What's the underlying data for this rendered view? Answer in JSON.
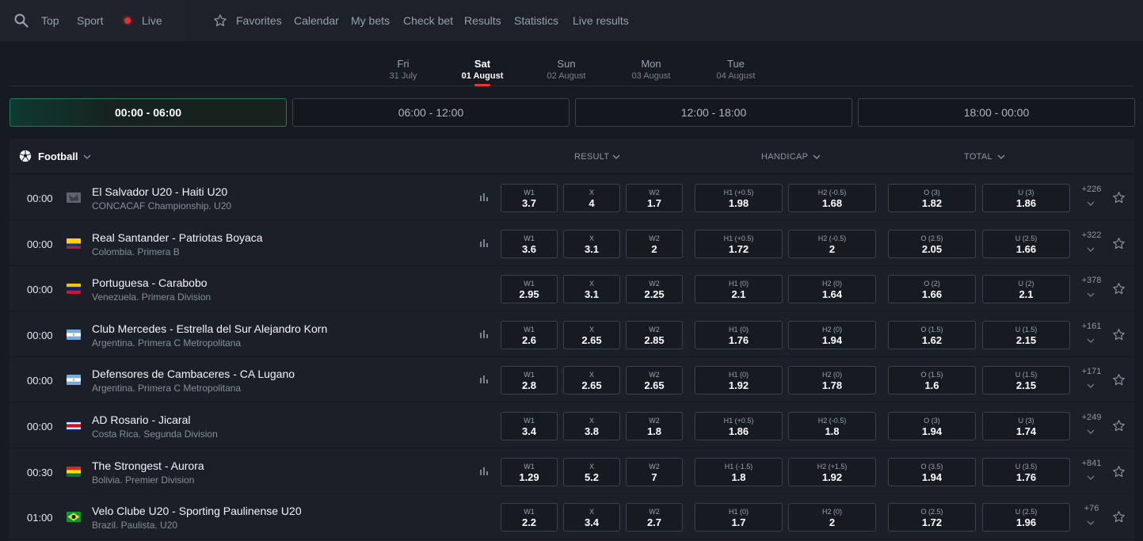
{
  "nav": {
    "left_items": [
      "Top",
      "Sport",
      "Live"
    ],
    "right_items": [
      "Favorites",
      "Calendar",
      "My bets",
      "Check bet",
      "Results",
      "Statistics",
      "Live results"
    ]
  },
  "dates": [
    {
      "day": "Fri",
      "date": "31 July",
      "active": false
    },
    {
      "day": "Sat",
      "date": "01 August",
      "active": true
    },
    {
      "day": "Sun",
      "date": "02 August",
      "active": false
    },
    {
      "day": "Mon",
      "date": "03 August",
      "active": false
    },
    {
      "day": "Tue",
      "date": "04 August",
      "active": false
    }
  ],
  "time_slots": [
    {
      "label": "00:00 - 06:00",
      "active": true
    },
    {
      "label": "06:00 - 12:00",
      "active": false
    },
    {
      "label": "12:00 - 18:00",
      "active": false
    },
    {
      "label": "18:00 - 00:00",
      "active": false
    }
  ],
  "table": {
    "sport": "Football",
    "columns": {
      "result": "RESULT",
      "handicap": "HANDICAP",
      "total": "TOTAL"
    },
    "matches": [
      {
        "time": "00:00",
        "flag": "unknown",
        "teams": "El Salvador U20 - Haiti U20",
        "league": "CONCACAF Championship. U20",
        "stats": true,
        "odds": [
          {
            "label": "W1",
            "value": "3.7"
          },
          {
            "label": "X",
            "value": "4"
          },
          {
            "label": "W2",
            "value": "1.7"
          },
          {
            "label": "H1 (+0.5)",
            "value": "1.98"
          },
          {
            "label": "H2 (-0.5)",
            "value": "1.68"
          },
          {
            "label": "O (3)",
            "value": "1.82"
          },
          {
            "label": "U (3)",
            "value": "1.86"
          }
        ],
        "more": "+226"
      },
      {
        "time": "00:00",
        "flag": "colombia",
        "teams": "Real Santander - Patriotas Boyaca",
        "league": "Colombia. Primera B",
        "stats": true,
        "odds": [
          {
            "label": "W1",
            "value": "3.6"
          },
          {
            "label": "X",
            "value": "3.1"
          },
          {
            "label": "W2",
            "value": "2"
          },
          {
            "label": "H1 (+0.5)",
            "value": "1.72"
          },
          {
            "label": "H2 (-0.5)",
            "value": "2"
          },
          {
            "label": "O (2.5)",
            "value": "2.05"
          },
          {
            "label": "U (2.5)",
            "value": "1.66"
          }
        ],
        "more": "+322"
      },
      {
        "time": "00:00",
        "flag": "venezuela",
        "teams": "Portuguesa - Carabobo",
        "league": "Venezuela. Primera Division",
        "stats": false,
        "odds": [
          {
            "label": "W1",
            "value": "2.95"
          },
          {
            "label": "X",
            "value": "3.1"
          },
          {
            "label": "W2",
            "value": "2.25"
          },
          {
            "label": "H1 (0)",
            "value": "2.1"
          },
          {
            "label": "H2 (0)",
            "value": "1.64"
          },
          {
            "label": "O (2)",
            "value": "1.66"
          },
          {
            "label": "U (2)",
            "value": "2.1"
          }
        ],
        "more": "+378"
      },
      {
        "time": "00:00",
        "flag": "argentina",
        "teams": "Club Mercedes - Estrella del Sur Alejandro Korn",
        "league": "Argentina. Primera C Metropolitana",
        "stats": true,
        "odds": [
          {
            "label": "W1",
            "value": "2.6"
          },
          {
            "label": "X",
            "value": "2.65"
          },
          {
            "label": "W2",
            "value": "2.85"
          },
          {
            "label": "H1 (0)",
            "value": "1.76"
          },
          {
            "label": "H2 (0)",
            "value": "1.94"
          },
          {
            "label": "O (1.5)",
            "value": "1.62"
          },
          {
            "label": "U (1.5)",
            "value": "2.15"
          }
        ],
        "more": "+161"
      },
      {
        "time": "00:00",
        "flag": "argentina",
        "teams": "Defensores de Cambaceres - CA Lugano",
        "league": "Argentina. Primera C Metropolitana",
        "stats": true,
        "odds": [
          {
            "label": "W1",
            "value": "2.8"
          },
          {
            "label": "X",
            "value": "2.65"
          },
          {
            "label": "W2",
            "value": "2.65"
          },
          {
            "label": "H1 (0)",
            "value": "1.92"
          },
          {
            "label": "H2 (0)",
            "value": "1.78"
          },
          {
            "label": "O (1.5)",
            "value": "1.6"
          },
          {
            "label": "U (1.5)",
            "value": "2.15"
          }
        ],
        "more": "+171"
      },
      {
        "time": "00:00",
        "flag": "costa-rica",
        "teams": "AD Rosario - Jicaral",
        "league": "Costa Rica. Segunda Division",
        "stats": false,
        "odds": [
          {
            "label": "W1",
            "value": "3.4"
          },
          {
            "label": "X",
            "value": "3.8"
          },
          {
            "label": "W2",
            "value": "1.8"
          },
          {
            "label": "H1 (+0.5)",
            "value": "1.86"
          },
          {
            "label": "H2 (-0.5)",
            "value": "1.8"
          },
          {
            "label": "O (3)",
            "value": "1.94"
          },
          {
            "label": "U (3)",
            "value": "1.74"
          }
        ],
        "more": "+249"
      },
      {
        "time": "00:30",
        "flag": "bolivia",
        "teams": "The Strongest - Aurora",
        "league": "Bolivia. Premier Division",
        "stats": true,
        "odds": [
          {
            "label": "W1",
            "value": "1.29"
          },
          {
            "label": "X",
            "value": "5.2"
          },
          {
            "label": "W2",
            "value": "7"
          },
          {
            "label": "H1 (-1.5)",
            "value": "1.8"
          },
          {
            "label": "H2 (+1.5)",
            "value": "1.92"
          },
          {
            "label": "O (3.5)",
            "value": "1.94"
          },
          {
            "label": "U (3.5)",
            "value": "1.76"
          }
        ],
        "more": "+841"
      },
      {
        "time": "01:00",
        "flag": "brazil",
        "teams": "Velo Clube U20 - Sporting Paulinense U20",
        "league": "Brazil. Paulista. U20",
        "stats": false,
        "odds": [
          {
            "label": "W1",
            "value": "2.2"
          },
          {
            "label": "X",
            "value": "3.4"
          },
          {
            "label": "W2",
            "value": "2.7"
          },
          {
            "label": "H1 (0)",
            "value": "1.7"
          },
          {
            "label": "H2 (0)",
            "value": "2"
          },
          {
            "label": "O (2.5)",
            "value": "1.72"
          },
          {
            "label": "U (2.5)",
            "value": "1.96"
          }
        ],
        "more": "+76"
      }
    ]
  },
  "colors": {
    "accent_green": "#1f7a5f",
    "live_red": "#e53030",
    "active_underline": "#e8392c"
  }
}
